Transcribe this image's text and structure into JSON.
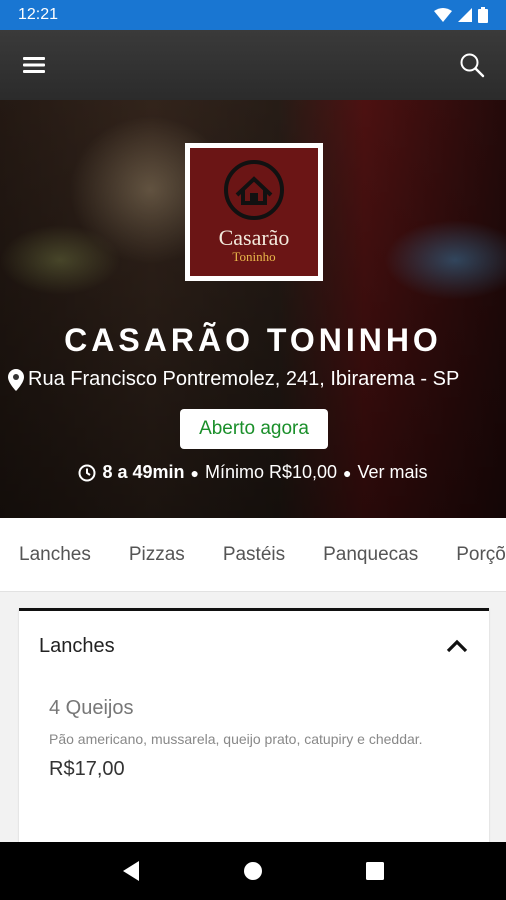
{
  "status_bar": {
    "time": "12:21"
  },
  "icons": {
    "menu": "hamburger-icon",
    "search": "search-icon",
    "clock": "clock-icon",
    "location": "location-pin-icon",
    "collapse": "chevron-up-icon"
  },
  "colors": {
    "status_bar": "#1976d2",
    "app_bar": "#333333",
    "open_badge_text": "#1a8f2a"
  },
  "restaurant": {
    "logo_name": "Casarão",
    "logo_sub": "Toninho",
    "name": "CASARÃO TONINHO",
    "address": "Rua Francisco Pontremolez, 241, Ibirarema - SP",
    "status_badge": "Aberto agora",
    "delivery_time": "8 a 49min",
    "minimum": "Mínimo R$10,00",
    "see_more": "Ver mais"
  },
  "tabs": [
    "Lanches",
    "Pizzas",
    "Pastéis",
    "Panquecas",
    "Porções"
  ],
  "section": {
    "title": "Lanches",
    "items": [
      {
        "name": "4 Queijos",
        "description": "Pão americano, mussarela, queijo prato, catupiry e cheddar.",
        "price": "R$17,00"
      }
    ]
  }
}
